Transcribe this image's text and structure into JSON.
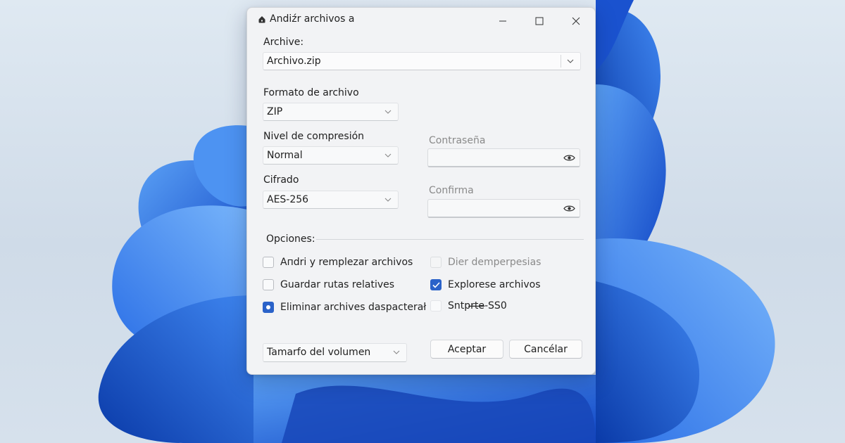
{
  "window": {
    "title": "Andiźr archivos a",
    "icons": {
      "app": "archive-icon",
      "minimize": "minimize-icon",
      "maximize": "maximize-icon",
      "close": "close-icon"
    }
  },
  "archive": {
    "label": "Archive:",
    "value": "Archivo.zip"
  },
  "format": {
    "label": "Formato de archivo",
    "value": "ZIP"
  },
  "compression": {
    "label": "Nivel de compresión",
    "value": "Normal"
  },
  "encryption": {
    "label": "Cifrado",
    "value": "AES-256"
  },
  "password": {
    "label": "Contraseña",
    "value": ""
  },
  "confirm": {
    "label": "Confirma",
    "value": ""
  },
  "options": {
    "label": "Opciones:",
    "items": [
      {
        "label": "Aпdri y remplezar archivos",
        "checked": false,
        "enabled": true
      },
      {
        "label": "Guardar rutas relatives",
        "checked": false,
        "enabled": true
      },
      {
        "label": "Eliminar archives daspacterał",
        "checked": true,
        "enabled": true
      },
      {
        "label": "Dier demperpesias",
        "checked": false,
        "enabled": false
      },
      {
        "label": "Explorese archivos",
        "checked": true,
        "enabled": true
      },
      {
        "label": "Sntpr̶t̶e̶-SS0",
        "checked": false,
        "enabled": true
      }
    ]
  },
  "volume": {
    "value": "Tamarfo del volumen"
  },
  "buttons": {
    "ok": "Aceptar",
    "cancel": "Cancélar"
  },
  "colors": {
    "accent": "#2a62c9",
    "dialog_bg": "#f2f3f5",
    "wallpaper_blue": "#1f5fd8"
  }
}
